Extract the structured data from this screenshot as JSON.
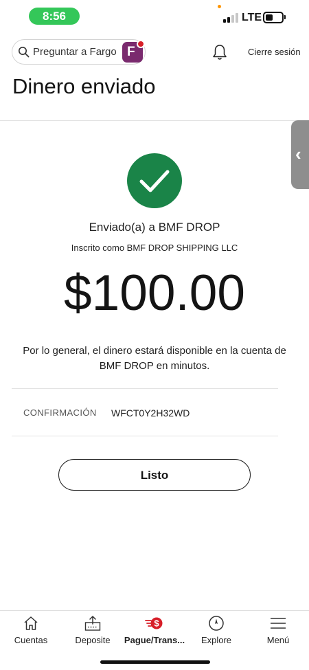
{
  "status_bar": {
    "time": "8:56",
    "network": "LTE"
  },
  "header": {
    "search_placeholder": "Preguntar a Fargo",
    "logout_label": "Cierre sesión",
    "title": "Dinero enviado"
  },
  "confirmation_screen": {
    "recipient_line": "Enviado(a) a BMF DROP",
    "enrolled_line": "Inscrito como BMF DROP SHIPPING LLC",
    "amount": "$100.00",
    "notice": "Por lo general, el dinero estará disponible en la cuenta de BMF DROP en minutos.",
    "confirmation_label": "CONFIRMACIÓN",
    "confirmation_value": "WFCT0Y2H32WD",
    "done_label": "Listo"
  },
  "tab_bar": {
    "items": [
      {
        "label": "Cuentas",
        "icon": "home-icon",
        "active": false
      },
      {
        "label": "Deposite",
        "icon": "deposit-icon",
        "active": false
      },
      {
        "label": "Pague/Trans...",
        "icon": "pay-transfer-icon",
        "active": true
      },
      {
        "label": "Explore",
        "icon": "compass-icon",
        "active": false
      },
      {
        "label": "Menú",
        "icon": "hamburger-menu-icon",
        "active": false
      }
    ]
  },
  "colors": {
    "success_green": "#1a8448",
    "brand_red": "#d71e28",
    "fargo_purple": "#7a2a6e",
    "status_pill_green": "#34c759"
  }
}
